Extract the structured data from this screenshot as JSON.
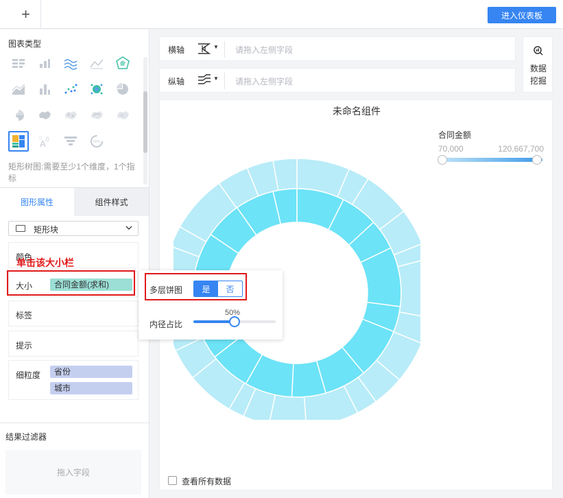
{
  "topbar": {
    "add_label": "+",
    "dashboard_button": "进入仪表板"
  },
  "left_panel": {
    "chart_type_title": "图表类型",
    "chart_type_hint": "矩形树图:需要至少1个维度，1个指标",
    "tabs": [
      "图形属性",
      "组件样式"
    ],
    "shape_select": "矩形块",
    "props": {
      "color": "颜色",
      "size": "大小",
      "size_value": "合同金额(求和)",
      "label": "标签",
      "tooltip": "提示",
      "granularity": "细粒度",
      "granularity_values": [
        "省份",
        "城市"
      ]
    },
    "annotation": "单击该大小栏",
    "filter_title": "结果过滤器",
    "filter_placeholder": "拖入字段"
  },
  "axes": {
    "x_label": "横轴",
    "y_label": "纵轴",
    "placeholder": "请拖入左侧字段"
  },
  "mine_button": [
    "数据",
    "挖掘"
  ],
  "canvas": {
    "title": "未命名组件",
    "legend_title": "合同金额",
    "legend_min": "70,000",
    "legend_max": "120,667,700",
    "show_all_label": "查看所有数据"
  },
  "popup": {
    "multilayer_label": "多层饼图",
    "yes": "是",
    "no": "否",
    "inner_radius_label": "内径占比",
    "inner_radius_value": "50%",
    "inner_radius_fraction": 0.5
  },
  "colors": {
    "accent": "#3685f2",
    "annotation": "#e0191a",
    "inner_ring": "#6ce3f7",
    "outer_ring": "#b8ecf8"
  }
}
